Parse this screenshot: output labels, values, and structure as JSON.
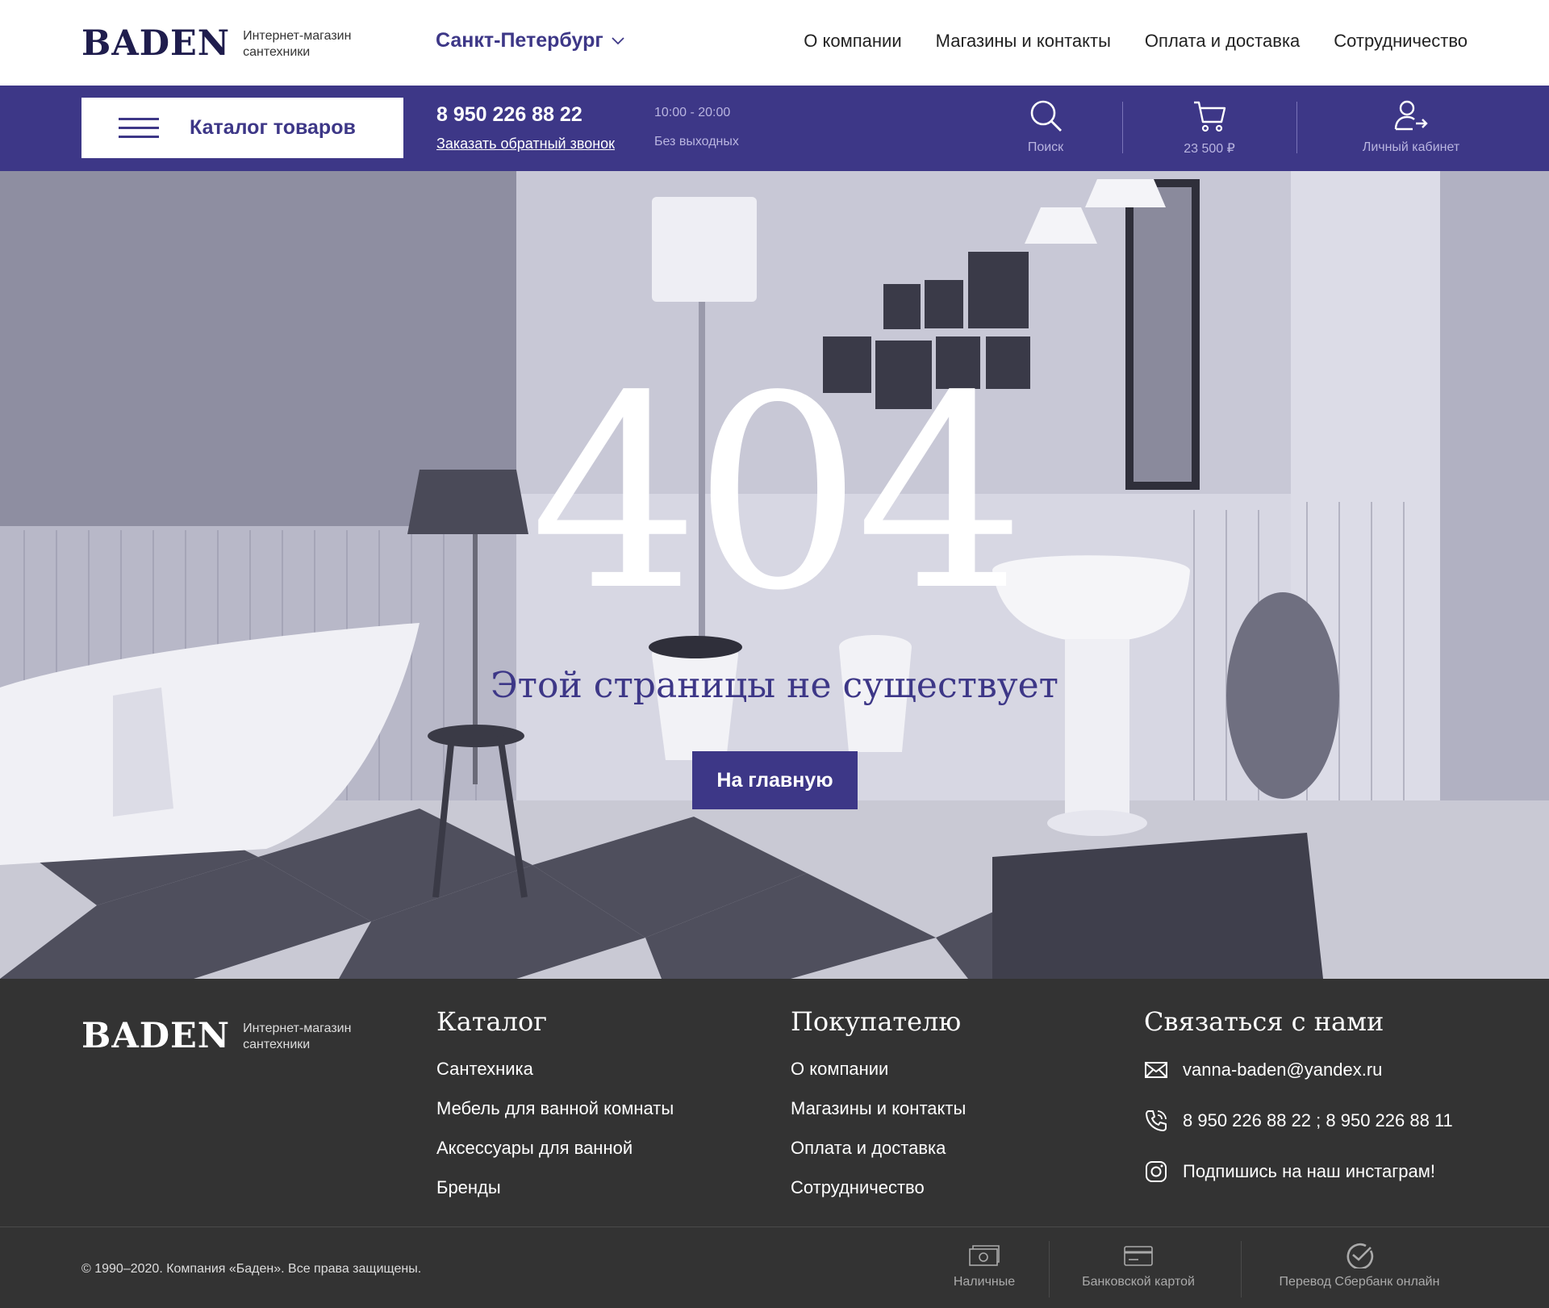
{
  "header": {
    "logo": "BADEN",
    "logo_subtitle_1": "Интернет-магазин",
    "logo_subtitle_2": "сантехники",
    "city": "Санкт-Петербург",
    "nav": [
      "О компании",
      "Магазины и контакты",
      "Оплата и доставка",
      "Сотрудничество"
    ]
  },
  "toolbar": {
    "catalog_label": "Каталог товаров",
    "phone": "8 950 226 88 22",
    "callback": "Заказать обратный звонок",
    "hours": "10:00 - 20:00",
    "days": "Без выходных",
    "search_label": "Поиск",
    "cart_label": "23 500 ₽",
    "account_label": "Личный кабинет"
  },
  "hero": {
    "code": "404",
    "message": "Этой страницы не существует",
    "home_button": "На главную"
  },
  "footer": {
    "logo": "BADEN",
    "logo_subtitle_1": "Интернет-магазин",
    "logo_subtitle_2": "сантехники",
    "catalog": {
      "title": "Каталог",
      "items": [
        "Сантехника",
        "Мебель для ванной комнаты",
        "Аксессуары для ванной",
        "Бренды"
      ]
    },
    "buyer": {
      "title": "Покупателю",
      "items": [
        "О компании",
        "Магазины и контакты",
        "Оплата и доставка",
        "Сотрудничество"
      ]
    },
    "contact": {
      "title": "Связаться с нами",
      "email": "vanna-baden@yandex.ru",
      "phones": "8 950 226 88 22 ; 8 950 226 88 11",
      "instagram": "Подпишись на наш инстаграм!"
    },
    "copyright": "© 1990–2020. Компания «Баден». Все права защищены.",
    "payments": [
      "Наличные",
      "Банковской картой",
      "Перевод Сбербанк онлайн"
    ]
  },
  "colors": {
    "brand": "#3d3787",
    "brand_muted": "#b9b5e0",
    "footer_bg": "#333333"
  },
  "icons": [
    "chevron-down-icon",
    "menu-icon",
    "search-icon",
    "cart-icon",
    "account-icon",
    "mail-icon",
    "phone-icon",
    "instagram-icon",
    "cash-icon",
    "card-icon",
    "check-icon"
  ]
}
